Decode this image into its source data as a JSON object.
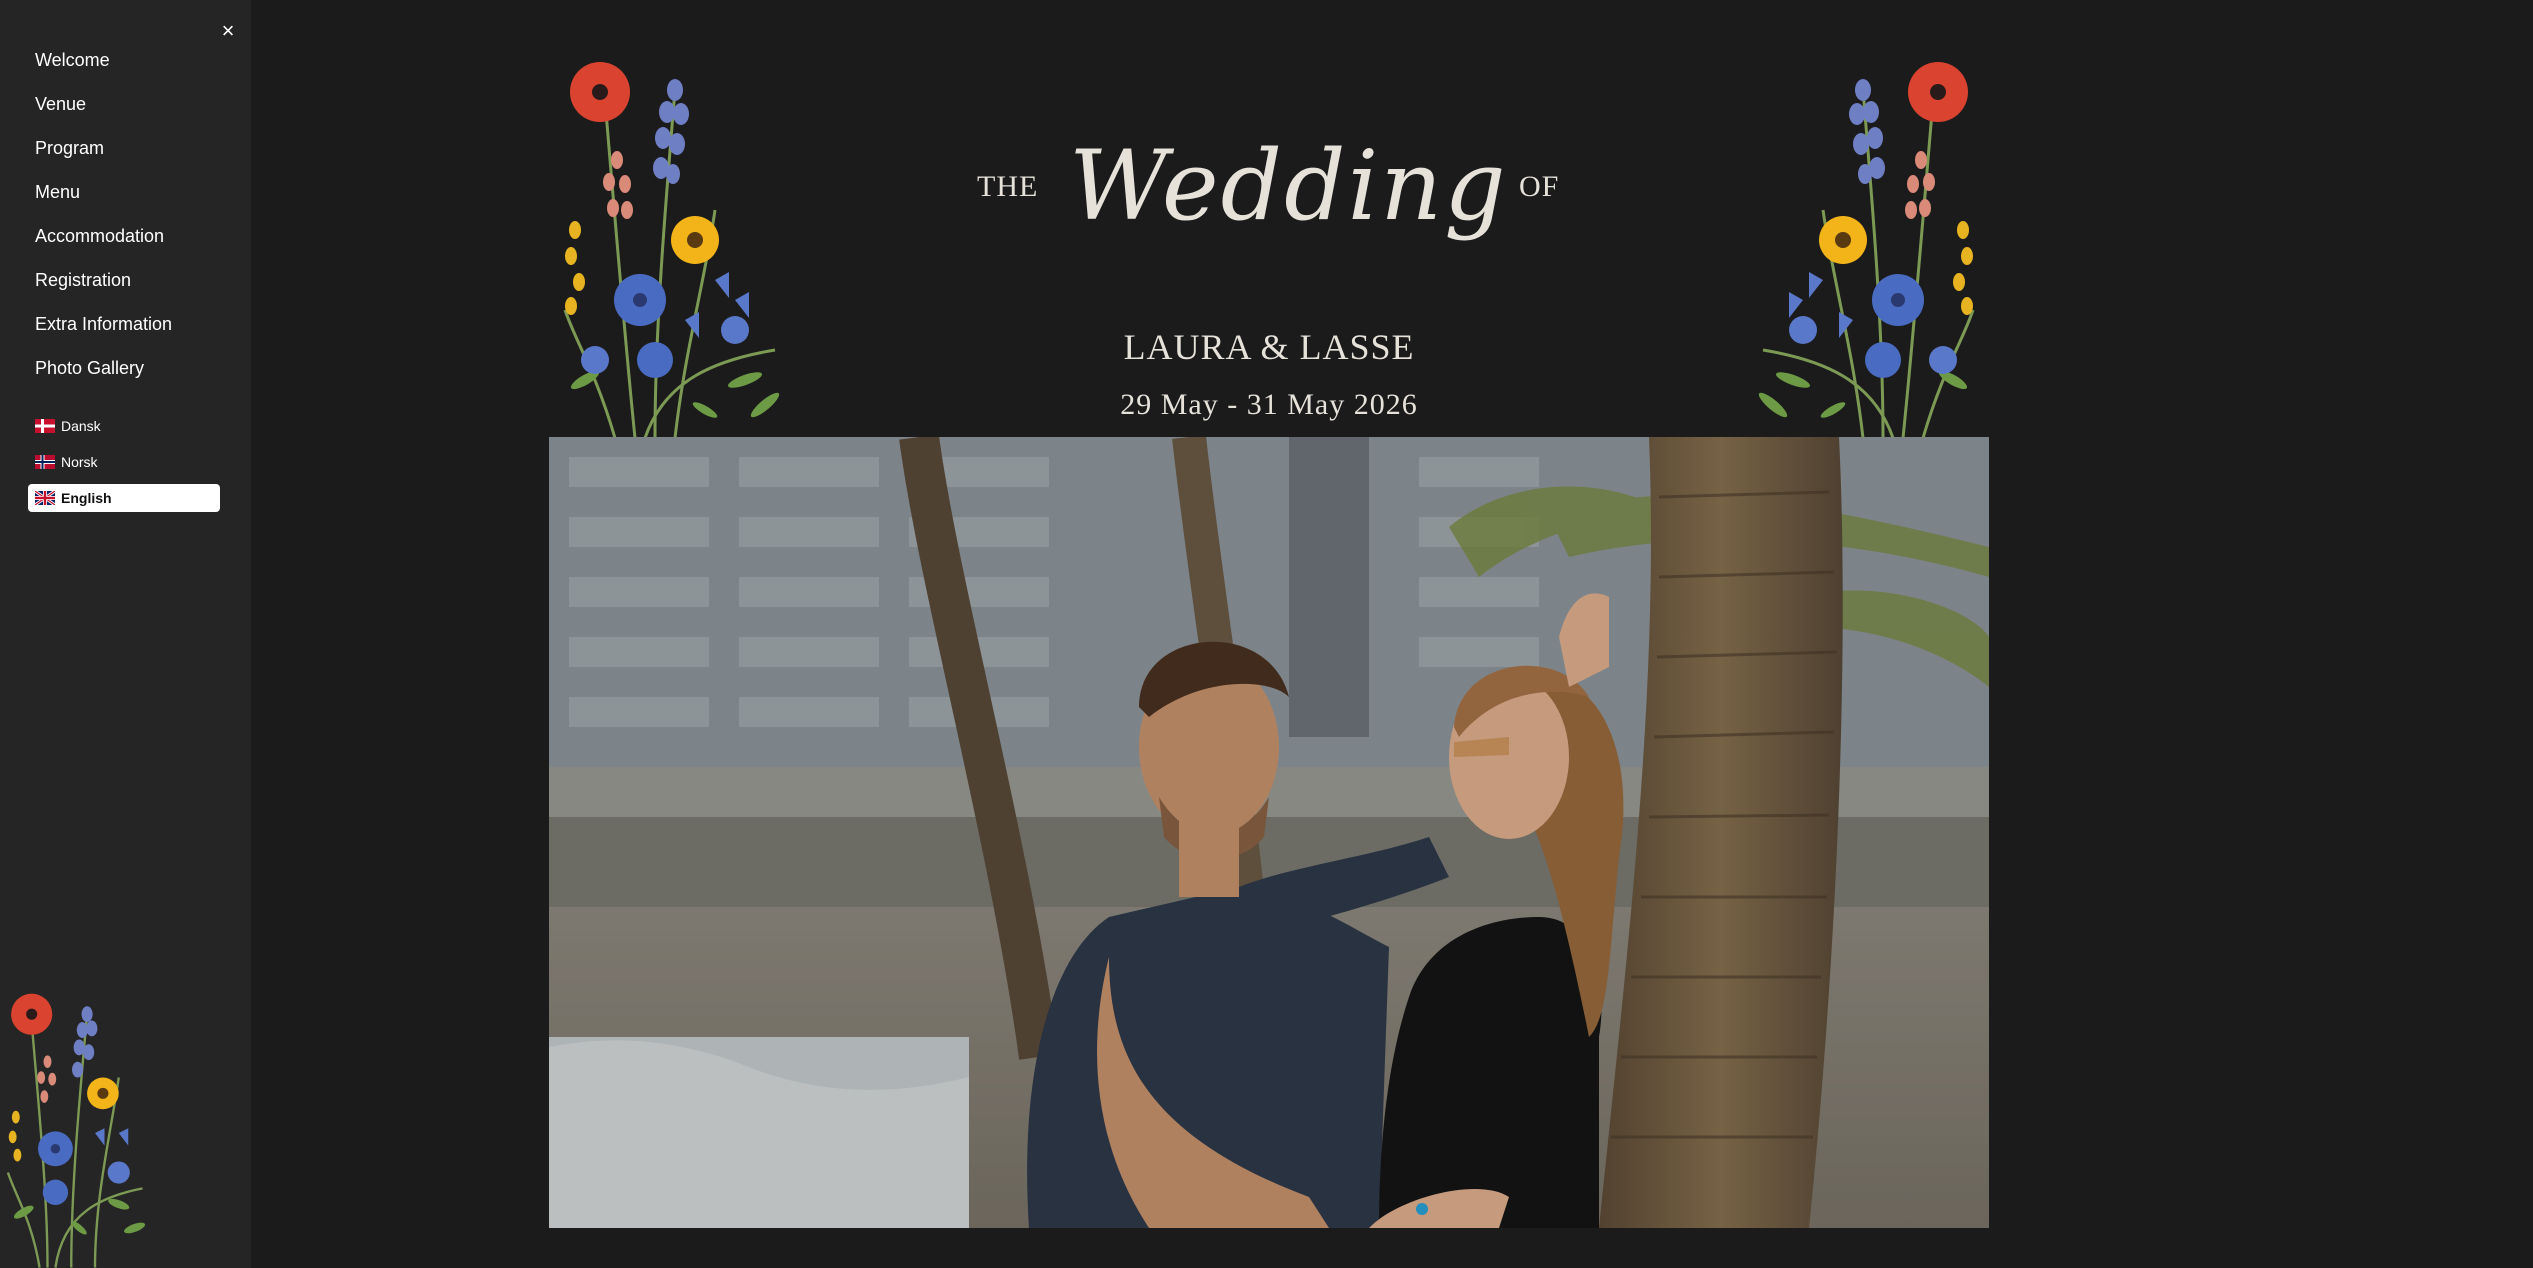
{
  "sidebar": {
    "close_icon": "×",
    "nav_items": [
      {
        "label": "Welcome"
      },
      {
        "label": "Venue"
      },
      {
        "label": "Program"
      },
      {
        "label": "Menu"
      },
      {
        "label": "Accommodation"
      },
      {
        "label": "Registration"
      },
      {
        "label": "Extra Information"
      },
      {
        "label": "Photo Gallery"
      }
    ],
    "languages": [
      {
        "label": "Dansk",
        "flag": "danish-flag-icon",
        "active": false
      },
      {
        "label": "Norsk",
        "flag": "norwegian-flag-icon",
        "active": false
      },
      {
        "label": "English",
        "flag": "uk-flag-icon",
        "active": true
      }
    ]
  },
  "header": {
    "the": "THE",
    "wedding": "Wedding",
    "of": "OF",
    "names": "LAURA & LASSE",
    "dates": "29 May - 31 May 2026"
  },
  "colors": {
    "background": "#1b1b1c",
    "sidebar": "#252526",
    "text": "#e6e2da",
    "poppy": "#d9432f",
    "lavender": "#6f7fc4",
    "cornflower": "#4a6bc2",
    "sunflower": "#e8b321",
    "leaf": "#7d9a55"
  }
}
